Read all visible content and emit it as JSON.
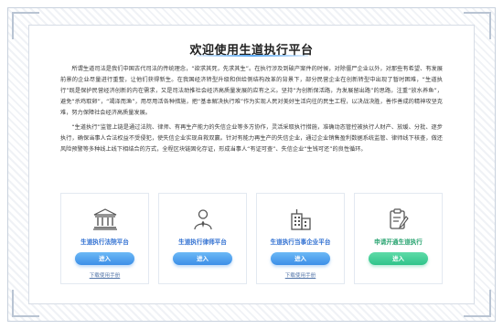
{
  "page": {
    "title": "欢迎使用生道执行平台",
    "paragraphs": [
      "所谓生道司法是我们中国古代司法的传统理念，“欲求其死，先求其生”。在执行涉及到破产案件的时候，对除僵尸企业以外，对那些有希望、有发展前景的企业尽量进行重整，让他们获得新生。在我国经济转型升级和供给侧结构改革的背景下，部分民营企业在创新转型中出现了暂时困难，“生道执行”既是保护民营经济创新的内在需求，又是司法助推社会经济高质量发展的应有之义。坚持“为创新保活路，为发展留出路”的思路，注重“放水养鱼”，避免“杀鸡取卵”，“竭泽而渔”，用尽用活各种措施，把“基本解决执行难”作为实现人民对美好生活向往的民生工程，以决战决胜，善作善成的精神攻坚克难，努力保障社会经济高质量发展。",
      "“生道执行”监管上链是通过法院、律师、有再生产能力的失信企业等多方协作，灵活采取执行措施，准确动态管控被执行人财产、放缓、分批、逐步执行，确保当事人合法权益不受侵犯，使失信企业实现自救双赢。针对有能力再生产的失信企业，通过企业销售盈利数据系统监管、律师线下核查，做还风险预警等多种线上线下相结合的方式，全程区块链固化存证，形成当事人“有证可查”、失信企业“生钱可还”的良性循环。"
    ],
    "cards": [
      {
        "label": "生道执行法院平台",
        "button": "进入",
        "manual": "下载使用手册",
        "icon": "court-building-icon"
      },
      {
        "label": "生道执行律师平台",
        "button": "进入",
        "manual": "",
        "icon": "lawyer-person-icon"
      },
      {
        "label": "生道执行当事企业平台",
        "button": "进入",
        "manual": "下载使用手册",
        "icon": "enterprise-building-icon"
      },
      {
        "label": "申请开通生道执行",
        "button": "进入",
        "manual": "",
        "icon": "apply-document-icon"
      }
    ]
  },
  "colors": {
    "accent_blue": "#3c8fe8",
    "accent_green": "#2fc48a",
    "label_blue": "#2f6fd1"
  }
}
